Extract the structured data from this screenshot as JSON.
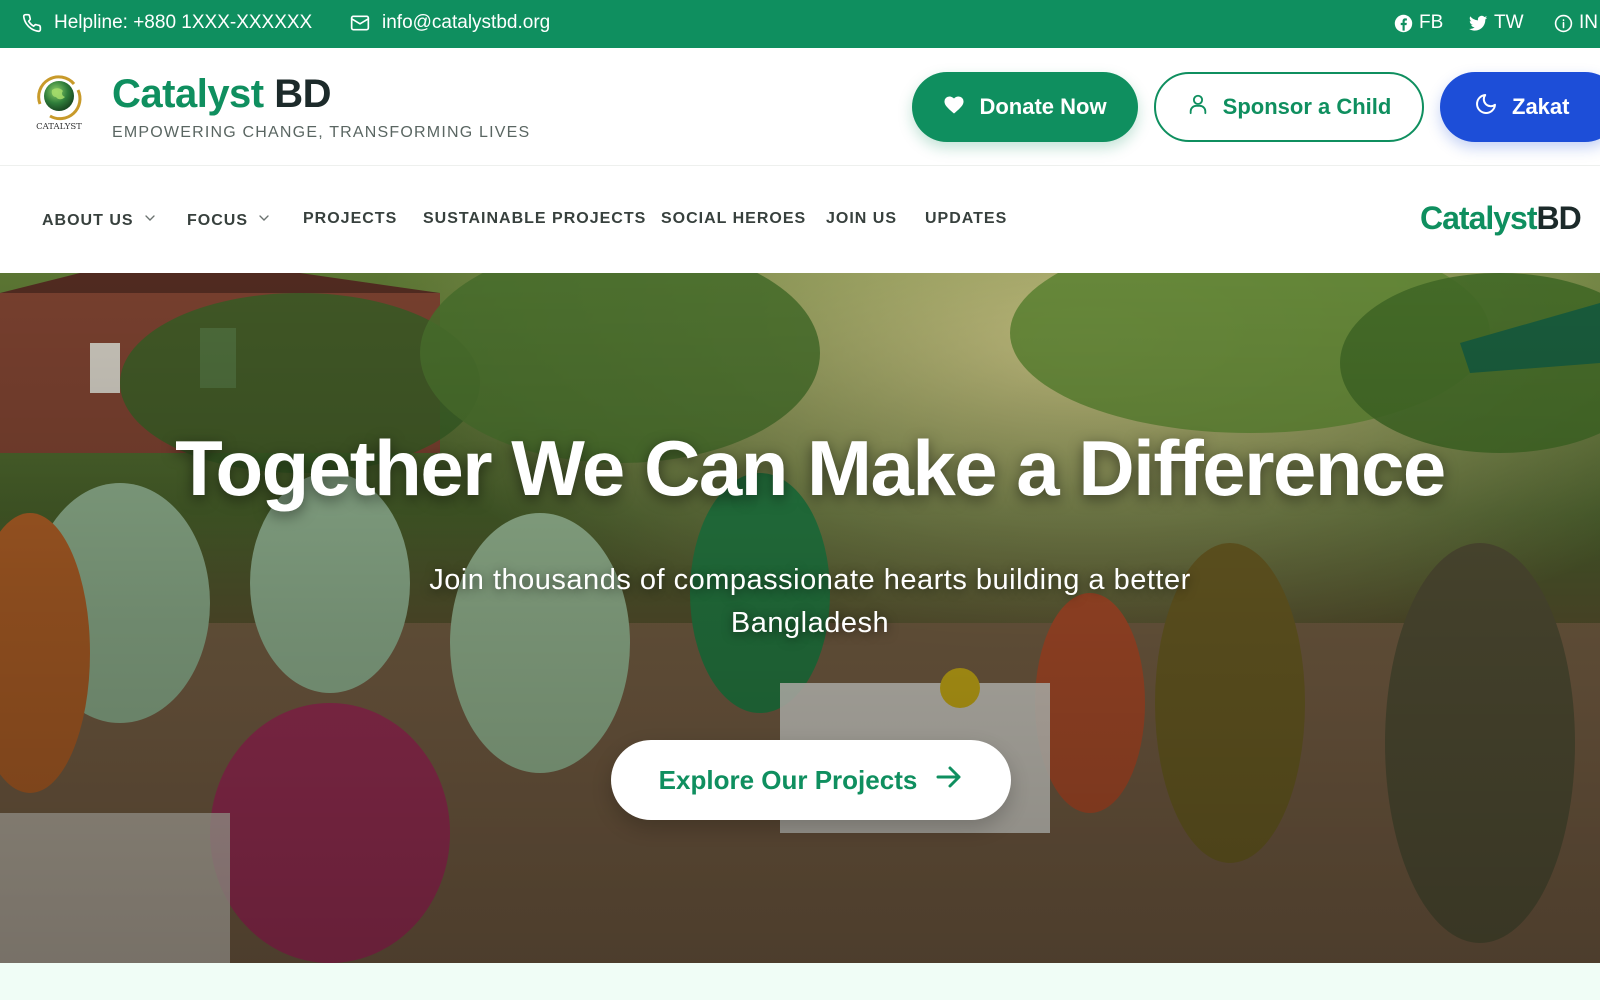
{
  "topbar": {
    "helpline": "Helpline: +880 1XXX-XXXXXX",
    "email": "info@catalystbd.org",
    "social": {
      "fb": "FB",
      "tw": "TW",
      "in": "IN"
    }
  },
  "header": {
    "brand_green": "Catalyst",
    "brand_dark": " BD",
    "logo_caption": "CATALYST",
    "tagline": "EMPOWERING CHANGE, TRANSFORMING LIVES",
    "buttons": {
      "donate": "Donate Now",
      "sponsor": "Sponsor a Child",
      "zakat": "Zakat"
    }
  },
  "nav": {
    "items": [
      "ABOUT US",
      "FOCUS",
      "PROJECTS",
      "SUSTAINABLE PROJECTS",
      "SOCIAL HEROES",
      "JOIN US",
      "UPDATES"
    ],
    "logo_green": "Catalyst",
    "logo_dark": "BD"
  },
  "hero": {
    "title": "Together We Can Make a Difference",
    "subtitle": "Join thousands of compassionate hearts building a better Bangladesh",
    "cta": "Explore Our Projects"
  },
  "colors": {
    "brand_green": "#0f8f5f",
    "zakat_blue": "#1d4ed8",
    "text_dark": "#1c2a2a"
  },
  "icons": {
    "helpline": "phone-icon",
    "email": "mail-icon",
    "fb": "facebook-icon",
    "tw": "twitter-icon",
    "in": "info-icon",
    "donate": "heart-icon",
    "sponsor": "user-icon",
    "zakat": "moon-icon",
    "cta": "arrow-right-icon",
    "dropdown": "chevron-down-icon"
  }
}
